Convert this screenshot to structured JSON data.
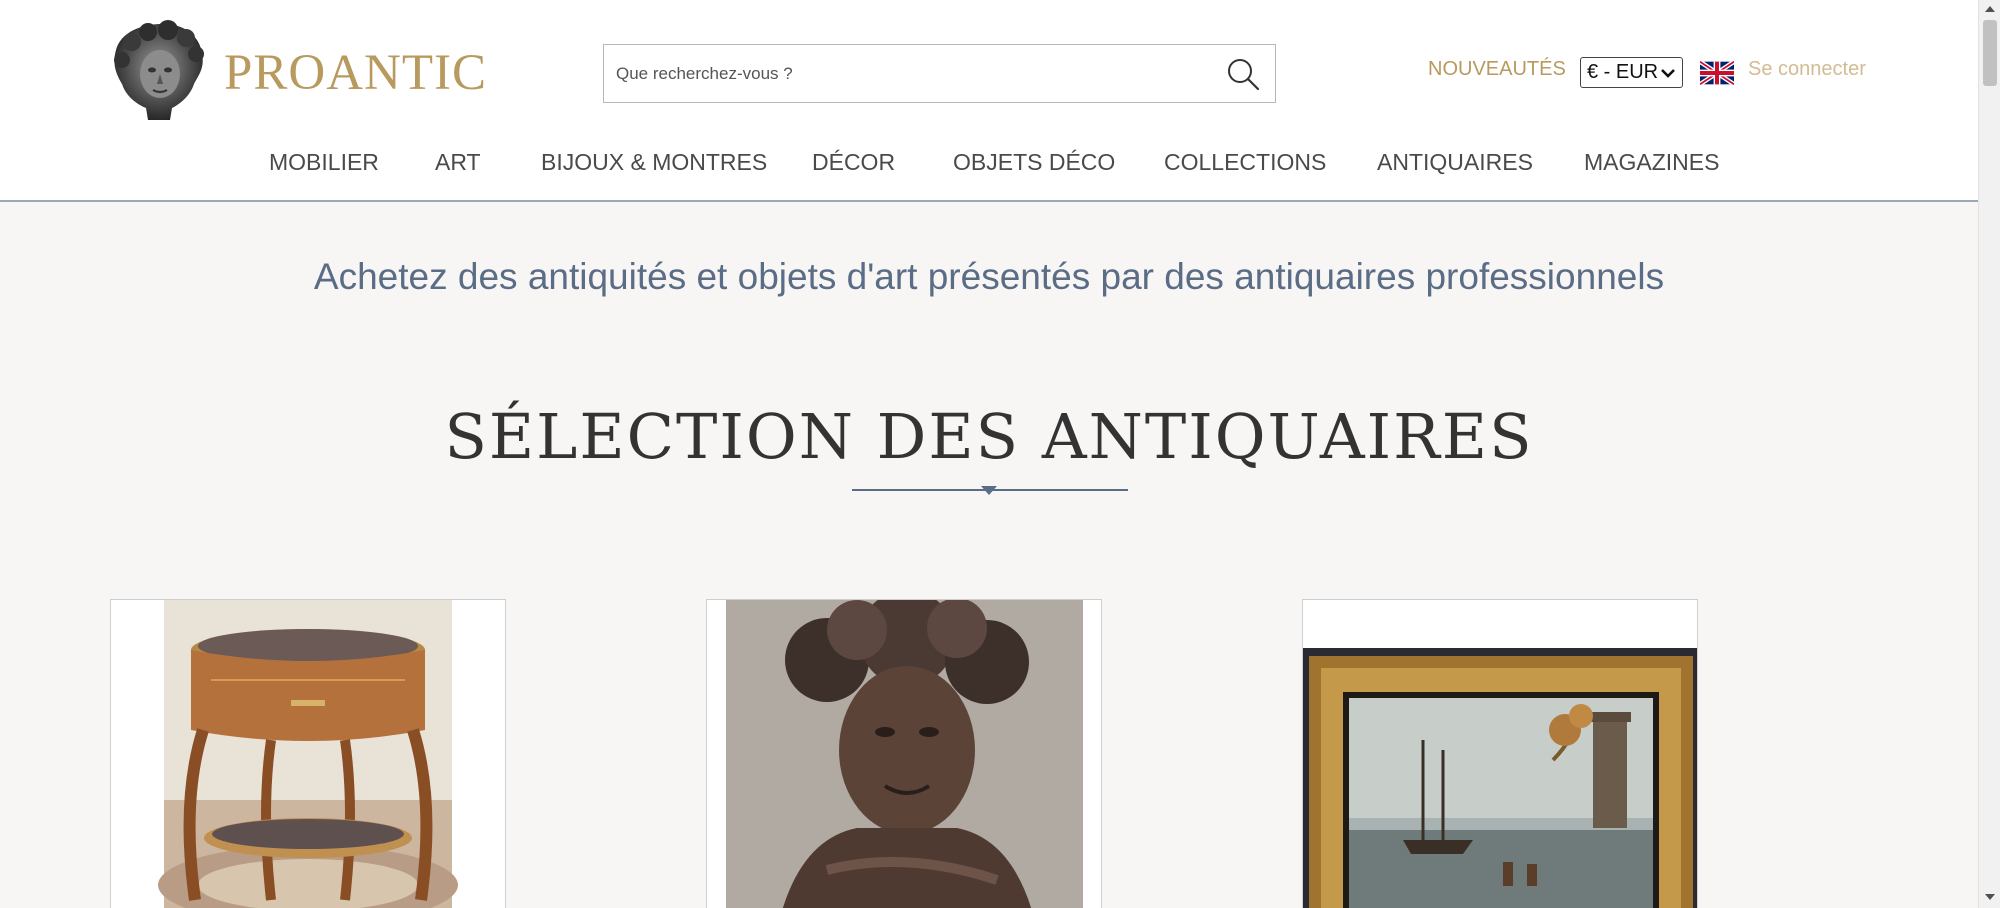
{
  "header": {
    "logo_text": "PROANTIC",
    "search": {
      "placeholder": "Que recherchez-vous ?"
    },
    "new_link": "NOUVEAUTÉS",
    "currency": "€ - EUR",
    "login_link": "Se connecter"
  },
  "nav": {
    "items": [
      "MOBILIER",
      "ART",
      "BIJOUX & MONTRES",
      "DÉCOR",
      "OBJETS DÉCO",
      "COLLECTIONS",
      "ANTIQUAIRES",
      "MAGAZINES"
    ]
  },
  "main": {
    "tagline": "Achetez des antiquités et objets d'art présentés par des antiquaires professionnels",
    "section_title": "SÉLECTION DES ANTIQUAIRES"
  },
  "cards": [
    {
      "image": "round-marquetry-side-table"
    },
    {
      "image": "bronze-bacchus-bust"
    },
    {
      "image": "framed-marine-painting"
    }
  ],
  "colors": {
    "brand_gold": "#b89a5f",
    "login_gold": "#d3bb93",
    "accent_slate": "#5a6c86",
    "page_bg": "#f7f6f4"
  }
}
